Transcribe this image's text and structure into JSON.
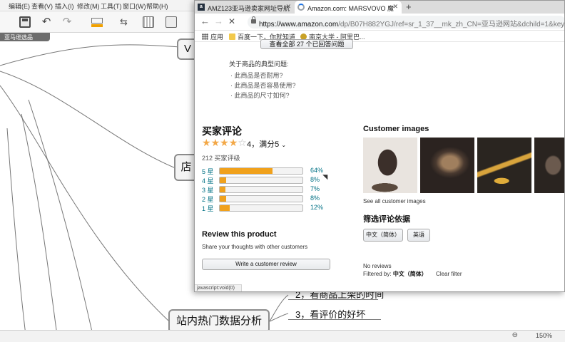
{
  "mindmap": {
    "menus": [
      "编辑(E)",
      "查看(V)",
      "插入(I)",
      "修改(M)",
      "工具(T)",
      "窗口(W)",
      "帮助(H)"
    ],
    "doc_tab": "亚马逊选品",
    "nodes": {
      "v_node": "V",
      "shop_node": "店",
      "hot_data": "站内热门数据分析"
    },
    "subtopics": [
      "2，看商品上架的时间",
      "3，看评价的好坏"
    ],
    "zoom": "150%"
  },
  "browser": {
    "tabs": [
      {
        "title": "AMZ123亚马逊卖家网址导航",
        "icon": "amazon-tab-icon"
      },
      {
        "title": "Amazon.com: MARSVOVO 魔",
        "icon": "loading-spinner-icon"
      }
    ],
    "url": {
      "host": "https://www.amazon.com",
      "rest": "/dp/B07H882YGJ/ref=sr_1_37__mk_zh_CN=亚马逊网站&dchild=1&keywords=boy..."
    },
    "bookmarks": [
      {
        "label": "应用",
        "icon": "apps-icon"
      },
      {
        "label": "百度一下，你就知道",
        "icon": "folder-icon"
      },
      {
        "label": "南京大学 - 阿里巴...",
        "icon": "nju-icon"
      }
    ],
    "status_link": "javascript:void(0)"
  },
  "page": {
    "qa_button": "查看全部 27 个已回答问题",
    "faq": {
      "title": "关于商品的典型问题:",
      "items": [
        "此商品是否耐用?",
        "此商品是否容易使用?",
        "此商品的尺寸如何?"
      ]
    },
    "reviews": {
      "title": "买家评论",
      "rating_text": "4，满分5",
      "rating_value": 4,
      "rating_max": 5,
      "count_text": "212 买家评级",
      "histogram": [
        {
          "label": "5 星",
          "percent": 64,
          "percent_text": "64%"
        },
        {
          "label": "4 星",
          "percent": 8,
          "percent_text": "8%"
        },
        {
          "label": "3 星",
          "percent": 7,
          "percent_text": "7%"
        },
        {
          "label": "2 星",
          "percent": 8,
          "percent_text": "8%"
        },
        {
          "label": "1 星",
          "percent": 12,
          "percent_text": "12%"
        }
      ],
      "bar_color": "#f0a11c"
    },
    "review_product": {
      "title": "Review this product",
      "subtitle": "Share your thoughts with other customers",
      "button": "Write a customer review"
    },
    "customer_images": {
      "title": "Customer images",
      "see_all": "See all customer images"
    },
    "filter": {
      "title": "筛选评论依据",
      "chips": [
        "中文（简体）",
        "英语"
      ],
      "no_reviews": "No reviews",
      "filtered_by_label": "Filtered by:",
      "filtered_by_value": "中文（简体）",
      "clear": "Clear filter"
    }
  }
}
